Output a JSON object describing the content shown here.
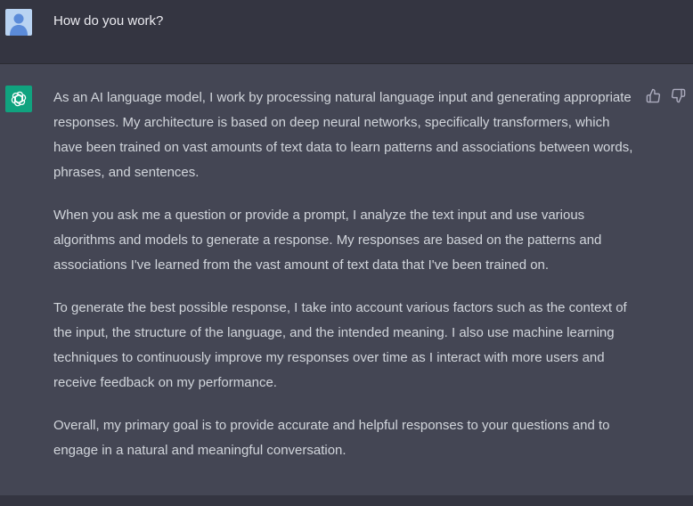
{
  "user_message": {
    "text": "How do you work?"
  },
  "assistant_message": {
    "paragraphs": [
      "As an AI language model, I work by processing natural language input and generating appropriate responses. My architecture is based on deep neural networks, specifically transformers, which have been trained on vast amounts of text data to learn patterns and associations between words, phrases, and sentences.",
      "When you ask me a question or provide a prompt, I analyze the text input and use various algorithms and models to generate a response. My responses are based on the patterns and associations I've learned from the vast amount of text data that I've been trained on.",
      "To generate the best possible response, I take into account various factors such as the context of the input, the structure of the language, and the intended meaning. I also use machine learning techniques to continuously improve my responses over time as I interact with more users and receive feedback on my performance.",
      "Overall, my primary goal is to provide accurate and helpful responses to your questions and to engage in a natural and meaningful conversation."
    ]
  },
  "icons": {
    "user_avatar": "user-avatar-icon",
    "assistant_avatar": "openai-logo-icon",
    "like": "thumbs-up-icon",
    "dislike": "thumbs-down-icon"
  },
  "colors": {
    "user_row_bg": "#343541",
    "assistant_row_bg": "#444654",
    "assistant_avatar_bg": "#10a37f",
    "user_avatar_bg": "#b9d3f2",
    "text": "#d1d5db"
  }
}
